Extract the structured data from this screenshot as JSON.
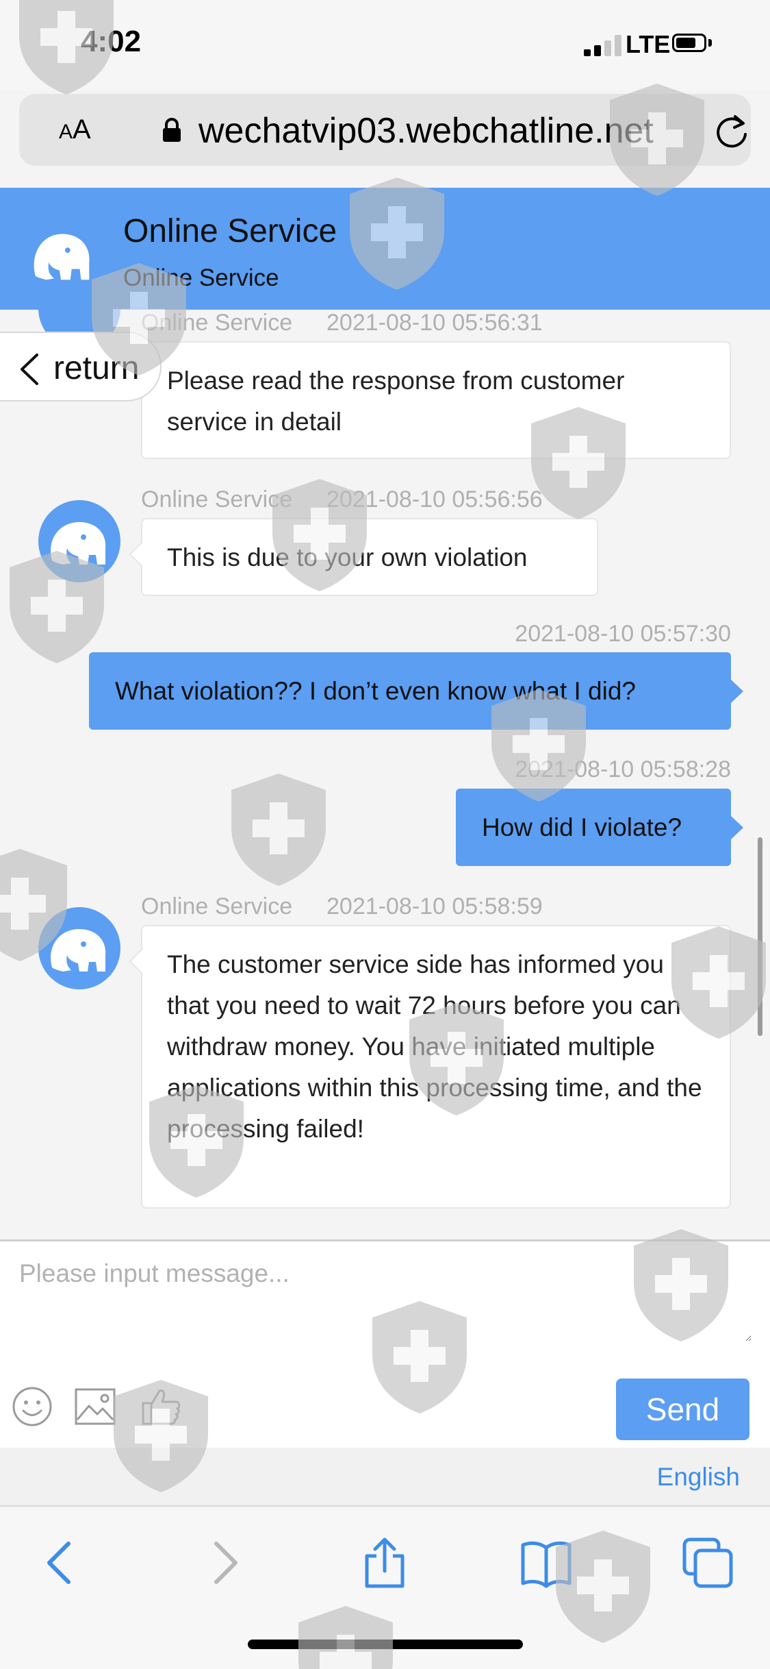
{
  "status_bar": {
    "time": "4:02",
    "carrier": "LTE"
  },
  "browser": {
    "text_size_label_small": "A",
    "text_size_label_large": "A",
    "url": "wechatvip03.webchatline.net"
  },
  "chat_header": {
    "title": "Online Service",
    "subtitle": "Online Service"
  },
  "return_label": "return",
  "messages": [
    {
      "sender": "Online Service",
      "time": "2021-08-10 05:56:31",
      "text": "Please read the response from customer service in detail"
    },
    {
      "sender": "Online Service",
      "time": "2021-08-10 05:56:56",
      "text": "This is due to your own violation"
    },
    {
      "time": "2021-08-10 05:57:30",
      "text": "What violation??  I don’t even know what I did?"
    },
    {
      "time": "2021-08-10 05:58:28",
      "text": "How did I violate?"
    },
    {
      "sender": "Online Service",
      "time": "2021-08-10 05:58:59",
      "text": "The customer service side has informed you that you need to wait 72 hours before you can withdraw money. You have initiated multiple applications within this processing time, and the processing failed!"
    }
  ],
  "input": {
    "placeholder": "Please input message..."
  },
  "send_label": "Send",
  "language_label": "English",
  "colors": {
    "accent": "#5b9ef2",
    "link": "#3c8ce8"
  },
  "icons": [
    "lock-icon",
    "reload-icon",
    "elephant-avatar-icon",
    "chevron-left-icon",
    "emoji-icon",
    "image-icon",
    "thumbs-up-icon",
    "back-icon",
    "forward-icon",
    "share-icon",
    "bookmarks-icon",
    "tabs-icon",
    "shield-watermark-icon"
  ]
}
